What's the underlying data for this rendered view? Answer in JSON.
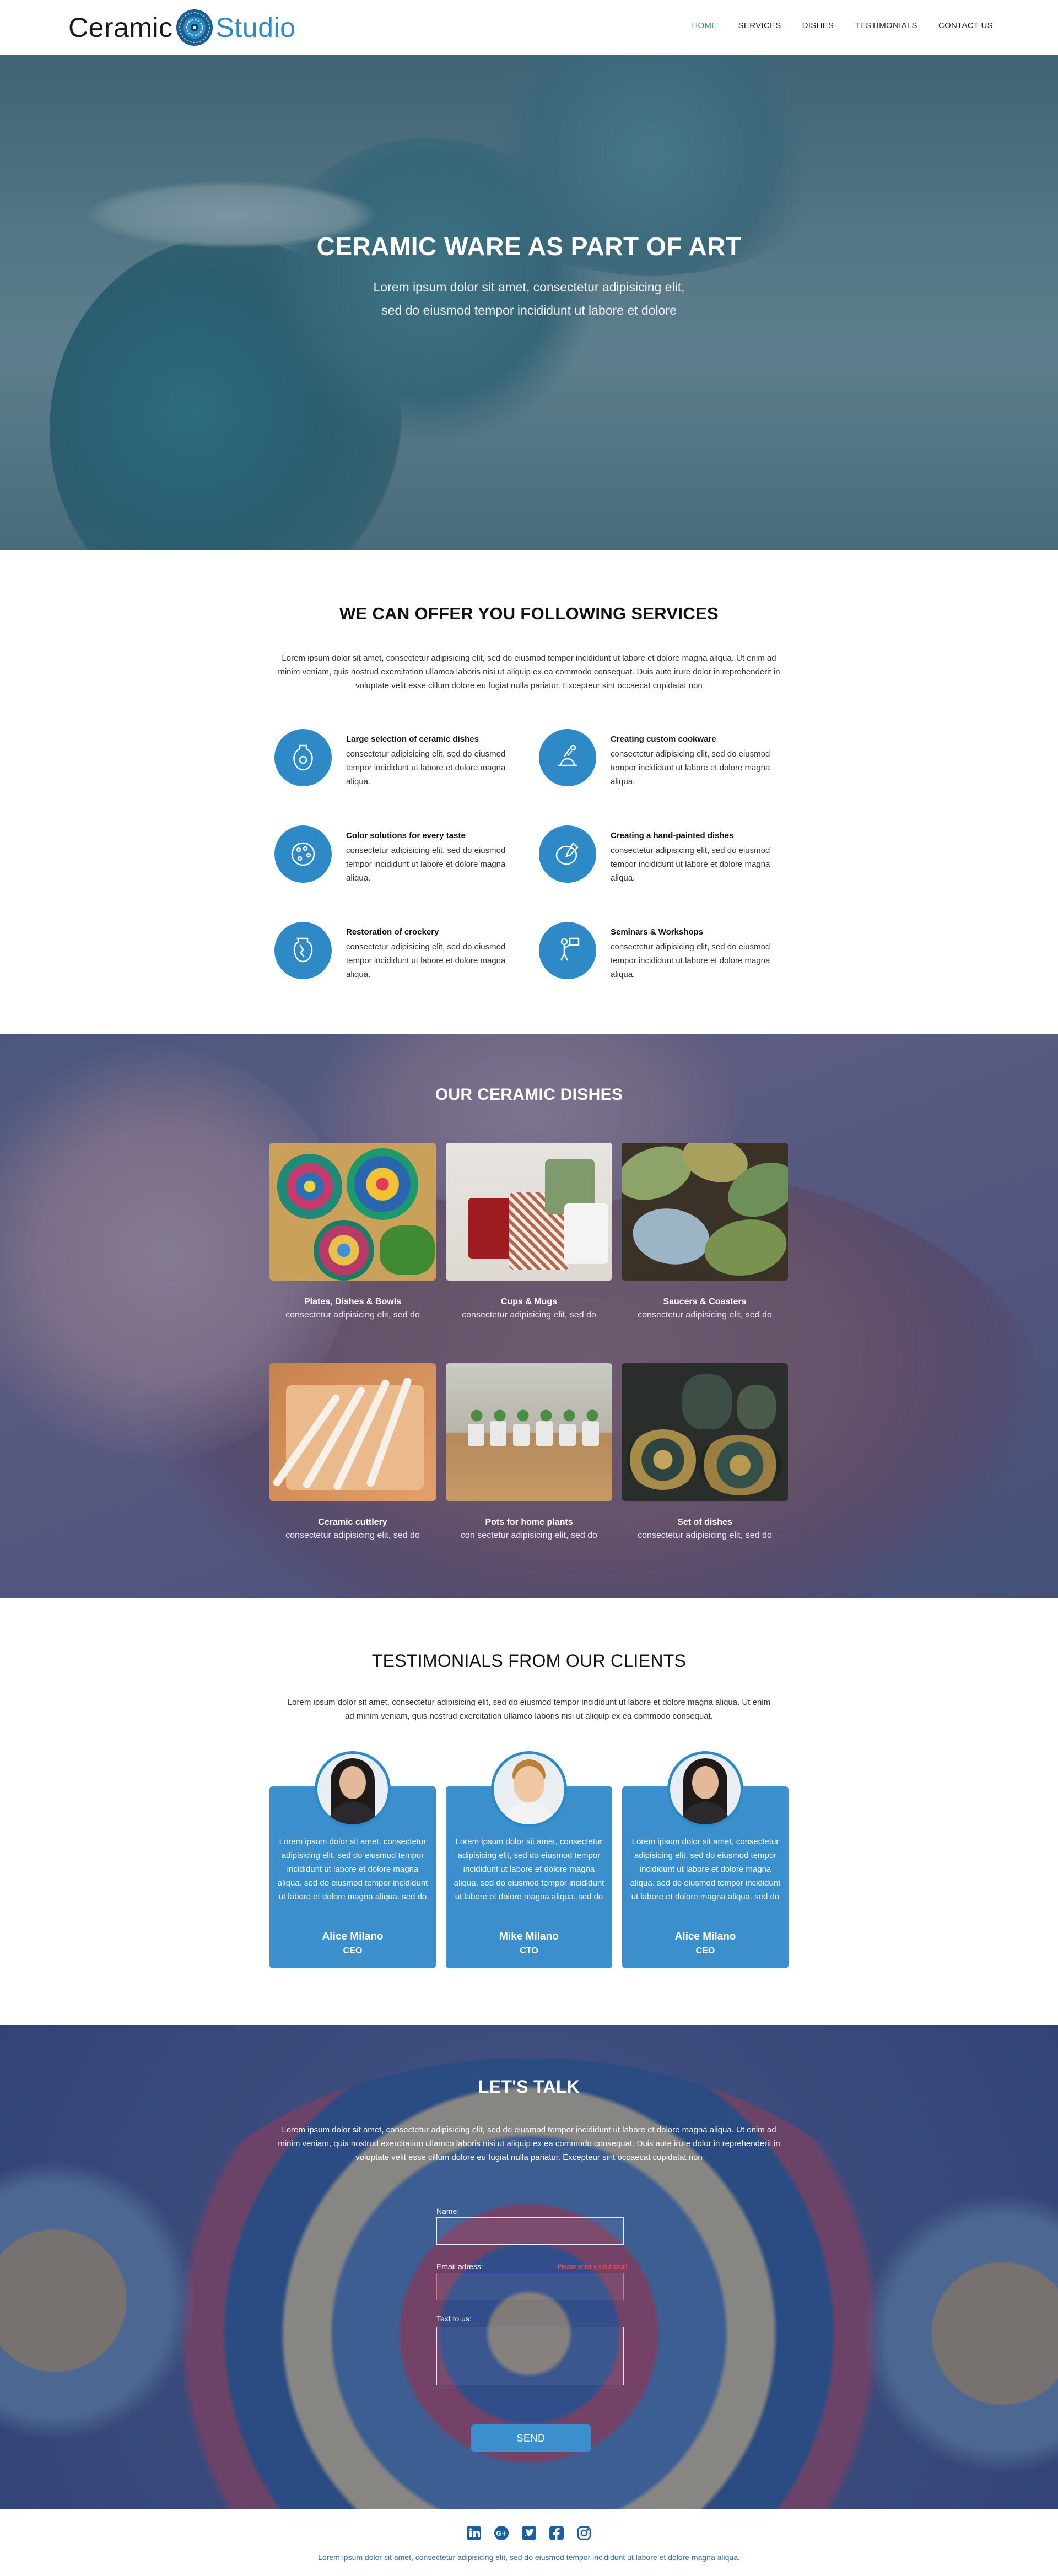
{
  "nav": {
    "logo_left": "Ceramic",
    "logo_right": "Studio",
    "items": [
      "HOME",
      "SERVICES",
      "DISHES",
      "TESTIMONIALS",
      "CONTACT US"
    ],
    "active_index": 0
  },
  "hero": {
    "title": "CERAMIC WARE AS PART OF ART",
    "subtitle_line1": "Lorem ipsum dolor sit amet, consectetur adipisicing elit,",
    "subtitle_line2": "sed do eiusmod tempor incididunt ut labore et dolore"
  },
  "services": {
    "title": "WE CAN OFFER YOU FOLLOWING SERVICES",
    "description": "Lorem ipsum dolor sit amet, consectetur adipisicing elit, sed do eiusmod tempor incididunt ut labore et dolore magna aliqua. Ut enim ad minim veniam, quis nostrud exercitation ullamco laboris nisi ut aliquip ex ea commodo consequat. Duis aute irure dolor in reprehenderit in voluptate velit esse cillum dolore eu fugiat nulla pariatur. Excepteur sint occaecat cupidatat non",
    "items": [
      {
        "title": "Large selection of ceramic dishes",
        "text": "consectetur adipisicing elit, sed do eiusmod tempor incididunt ut labore et dolore magna aliqua.",
        "icon": "vase-icon"
      },
      {
        "title": "Creating custom cookware",
        "text": "consectetur adipisicing elit, sed do eiusmod tempor incididunt ut labore et dolore magna aliqua.",
        "icon": "pottery-wheel-icon"
      },
      {
        "title": "Color solutions for every taste",
        "text": "consectetur adipisicing elit, sed do eiusmod tempor incididunt ut labore et dolore magna aliqua.",
        "icon": "palette-icon"
      },
      {
        "title": "Creating a hand-painted dishes",
        "text": "consectetur adipisicing elit, sed do eiusmod tempor incididunt ut labore et dolore magna aliqua.",
        "icon": "painted-plate-icon"
      },
      {
        "title": "Restoration of crockery",
        "text": "consectetur adipisicing elit, sed do eiusmod tempor incididunt ut labore et dolore magna aliqua.",
        "icon": "broken-vase-icon"
      },
      {
        "title": "Seminars & Workshops",
        "text": "consectetur adipisicing elit, sed do eiusmod tempor incididunt ut labore et dolore magna aliqua.",
        "icon": "teacher-icon"
      }
    ]
  },
  "dishes": {
    "title": "OUR CERAMIC DISHES",
    "items": [
      {
        "title": "Plates, Dishes & Bowls",
        "text": "consectetur adipisicing elit, sed do"
      },
      {
        "title": "Cups & Mugs",
        "text": "consectetur adipisicing elit, sed do"
      },
      {
        "title": "Saucers & Coasters",
        "text": "consectetur adipisicing elit, sed do"
      },
      {
        "title": "Ceramic cuttlery",
        "text": "consectetur adipisicing elit, sed do"
      },
      {
        "title": "Pots for home plants",
        "text": "con sectetur adipisicing elit, sed do"
      },
      {
        "title": "Set of dishes",
        "text": "consectetur adipisicing elit, sed do"
      }
    ]
  },
  "testimonials": {
    "title": "TESTIMONIALS FROM OUR CLIENTS",
    "description": "Lorem ipsum dolor sit amet, consectetur adipisicing elit, sed do eiusmod tempor incididunt ut labore et dolore magna aliqua. Ut enim ad minim veniam, quis nostrud exercitation ullamco laboris nisi ut aliquip ex ea commodo consequat.",
    "items": [
      {
        "text": "Lorem ipsum dolor sit amet, consectetur adipisicing elit, sed do eiusmod tempor incididunt ut labore et dolore magna aliqua. sed do eiusmod tempor incididunt ut labore et dolore magna aliqua. sed do",
        "name": "Alice Milano",
        "role": "CEO"
      },
      {
        "text": "Lorem ipsum dolor sit amet, consectetur adipisicing elit, sed do eiusmod tempor incididunt ut labore et dolore magna aliqua. sed do eiusmod tempor incididunt ut labore et dolore magna aliqua. sed do",
        "name": "Mike Milano",
        "role": "CTO"
      },
      {
        "text": "Lorem ipsum dolor sit amet, consectetur adipisicing elit, sed do eiusmod tempor incididunt ut labore et dolore magna aliqua. sed do eiusmod tempor incididunt ut labore et dolore magna aliqua. sed do",
        "name": "Alice Milano",
        "role": "CEO"
      }
    ]
  },
  "contact": {
    "title": "LET'S TALK",
    "description": "Lorem ipsum dolor sit amet, consectetur adipisicing elit, sed do eiusmod tempor incididunt ut labore et dolore magna aliqua. Ut enim ad minim veniam, quis nostrud exercitation ullamco laboris nisi ut aliquip ex ea commodo consequat. Duis aute irure dolor in reprehenderit in voluptate velit esse cillum dolore eu fugiat nulla pariatur. Excepteur sint occaecat cupidatat non",
    "name_label": "Name:",
    "email_label": "Email adress:",
    "email_error": "Please enter a valid email",
    "text_label": "Text to us:",
    "send_label": "SEND"
  },
  "footer": {
    "socials": [
      "linkedin-icon",
      "google-plus-icon",
      "twitter-icon",
      "facebook-icon",
      "instagram-icon"
    ],
    "text": "Lorem ipsum dolor sit amet, consectetur adipisicing elit, sed do eiusmod tempor incididunt ut labore et dolore magna aliqua."
  },
  "colors": {
    "accent": "#2d8ac7",
    "card": "#3a8fcc",
    "error": "#ff4d4d"
  }
}
